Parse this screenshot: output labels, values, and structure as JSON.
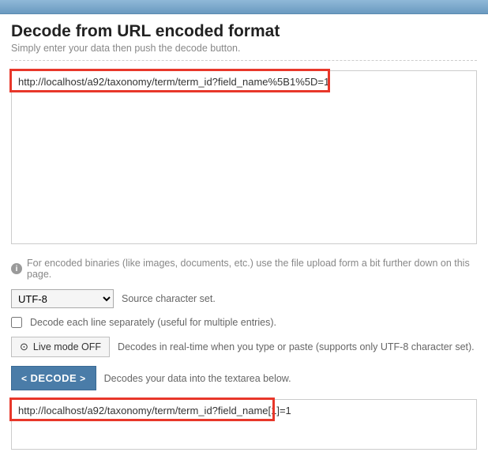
{
  "header": {
    "title": "Decode from URL encoded format",
    "subtitle": "Simply enter your data then push the decode button."
  },
  "input": {
    "value": "http://localhost/a92/taxonomy/term/term_id?field_name%5B1%5D=1"
  },
  "info": {
    "text": "For encoded binaries (like images, documents, etc.) use the file upload form a bit further down on this page."
  },
  "charset": {
    "selected": "UTF-8",
    "label": "Source character set."
  },
  "perline": {
    "label": "Decode each line separately (useful for multiple entries).",
    "checked": false
  },
  "livemode": {
    "button": "Live mode OFF",
    "label": "Decodes in real-time when you type or paste (supports only UTF-8 character set)."
  },
  "decode": {
    "button": "DECODE",
    "label": "Decodes your data into the textarea below."
  },
  "output": {
    "value": "http://localhost/a92/taxonomy/term/term_id?field_name[1]=1"
  }
}
